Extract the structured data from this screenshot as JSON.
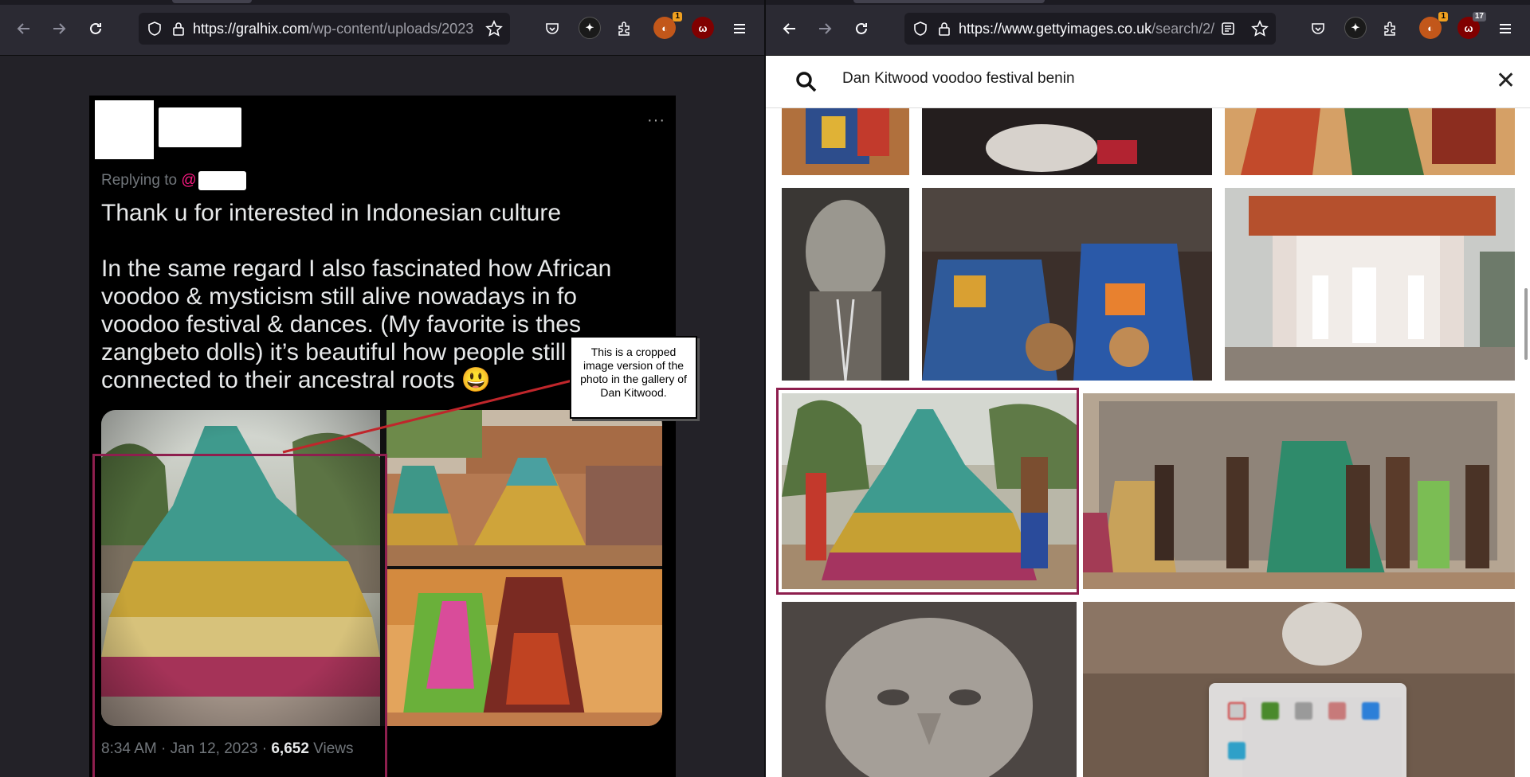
{
  "left_window": {
    "url_host": "https://gralhix.com",
    "url_rest": "/wp-content/uploads/2023",
    "extension_badge": "1",
    "tweet": {
      "replying_prefix": "Replying to ",
      "replying_at": "@",
      "text": "Thank u for interested in Indonesian culture\n\nIn the same regard I also fascinated how African voodoo & mysticism still alive nowadays in fo\nvoodoo festival & dances. (My favorite is thes\nzangbeto dolls) it’s beautiful how people still\nconnected to their ancestral roots 😃",
      "timestamp": "8:34 AM · Jan 12, 2023 · ",
      "views_count": "6,652",
      "views_label": " Views",
      "more_label": "···"
    },
    "callout_text": "This is a cropped image version of the photo in the gallery of Dan Kitwood."
  },
  "right_window": {
    "url_host": "https://www.gettyimages.co.uk",
    "url_rest": "/search/2/",
    "extension_badge_1": "1",
    "extension_badge_2": "17",
    "search_query": "Dan Kitwood voodoo festival benin"
  },
  "colors": {
    "highlight": "#8e1f4e",
    "toolbar": "#2b2a33",
    "tweet_bg": "#000000"
  }
}
